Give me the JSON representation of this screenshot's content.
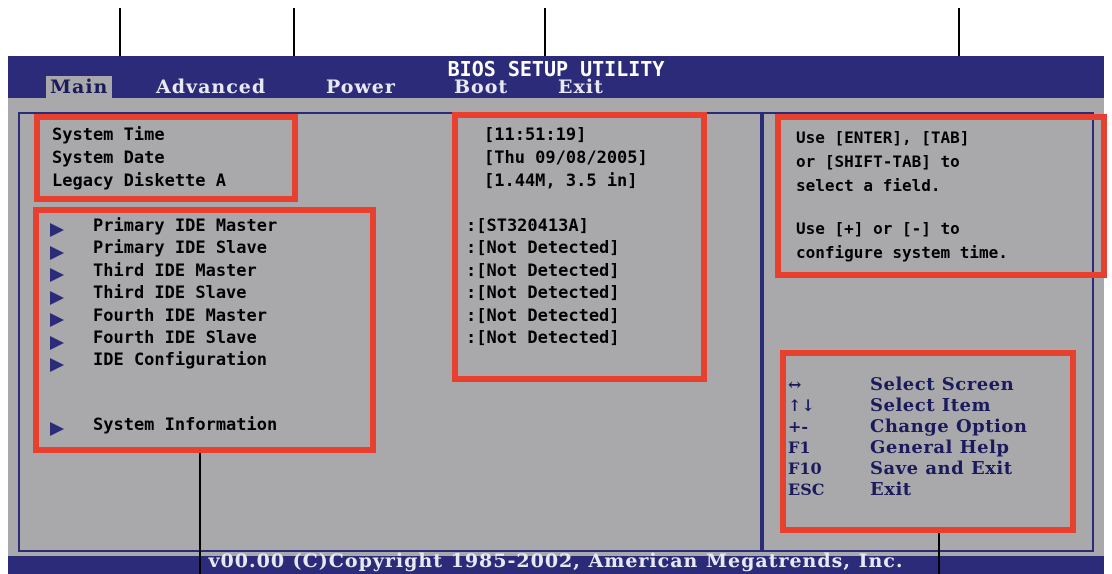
{
  "title": "BIOS SETUP UTILITY",
  "menu": [
    {
      "label": "Main",
      "active": true
    },
    {
      "label": "Advanced"
    },
    {
      "label": "Power"
    },
    {
      "label": "Boot"
    },
    {
      "label": "Exit"
    }
  ],
  "settings": [
    {
      "label": "System Time",
      "value": "[11:51:19]"
    },
    {
      "label": "System Date",
      "value": "[Thu 09/08/2005]"
    },
    {
      "label": "Legacy Diskette A",
      "value": "[1.44M, 3.5 in]"
    }
  ],
  "submenus": [
    {
      "label": "Primary IDE Master",
      "value": ":[ST320413A]"
    },
    {
      "label": "Primary IDE Slave",
      "value": ":[Not Detected]"
    },
    {
      "label": "Third IDE Master",
      "value": ":[Not Detected]"
    },
    {
      "label": "Third IDE Slave",
      "value": ":[Not Detected]"
    },
    {
      "label": "Fourth IDE Master",
      "value": ":[Not Detected]"
    },
    {
      "label": "Fourth IDE Slave",
      "value": ":[Not Detected]"
    },
    {
      "label": "IDE Configuration"
    },
    {
      "label": "System Information"
    }
  ],
  "help": {
    "lines": [
      "Use [ENTER], [TAB]",
      "or [SHIFT-TAB] to",
      "select a field.",
      "",
      "Use [+] or [-] to",
      "configure system time."
    ]
  },
  "keys": [
    {
      "key": "↔",
      "desc": "Select Screen"
    },
    {
      "key": "↑↓",
      "desc": "Select Item"
    },
    {
      "key": "+-",
      "desc": "Change Option"
    },
    {
      "key": "F1",
      "desc": "General Help"
    },
    {
      "key": "F10",
      "desc": "Save and Exit"
    },
    {
      "key": "ESC",
      "desc": "Exit"
    }
  ],
  "footer": "v00.00 (C)Copyright 1985-2002, American Megatrends, Inc.",
  "colors": {
    "background": "#a9a9ab",
    "bar": "#2b2b7a",
    "highlight": "#e8402e"
  }
}
